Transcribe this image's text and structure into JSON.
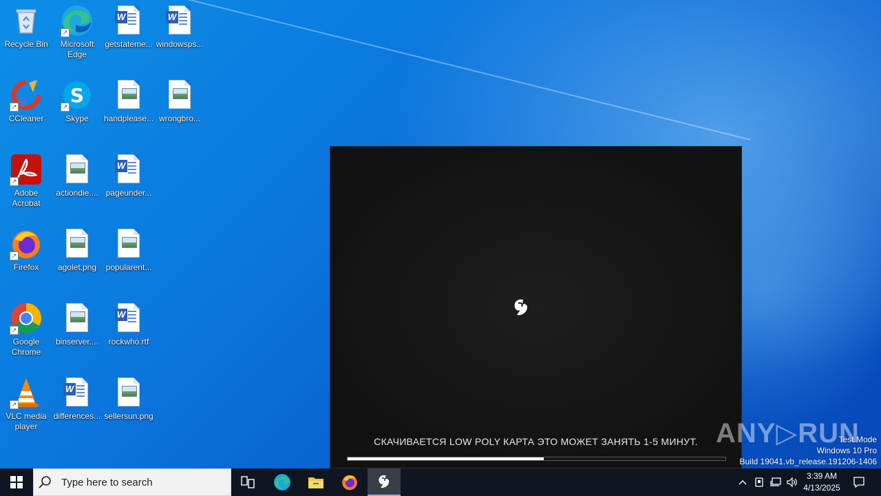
{
  "desktop": {
    "icons": [
      {
        "label": "Recycle Bin",
        "kind": "recycle-bin-icon"
      },
      {
        "label": "Microsoft Edge",
        "kind": "edge-icon"
      },
      {
        "label": "getstateme...",
        "kind": "word-doc-icon"
      },
      {
        "label": "windowsps...",
        "kind": "word-doc-icon"
      },
      {
        "label": "CCleaner",
        "kind": "ccleaner-icon"
      },
      {
        "label": "Skype",
        "kind": "skype-icon"
      },
      {
        "label": "handplease...",
        "kind": "image-file-icon"
      },
      {
        "label": "wrongbro...",
        "kind": "image-file-icon"
      },
      {
        "label": "Adobe Acrobat",
        "kind": "acrobat-icon"
      },
      {
        "label": "actiondie....",
        "kind": "image-file-icon"
      },
      {
        "label": "pageunder...",
        "kind": "word-doc-icon"
      },
      {
        "label": "Firefox",
        "kind": "firefox-icon"
      },
      {
        "label": "agolet.png",
        "kind": "image-file-icon"
      },
      {
        "label": "popularent...",
        "kind": "image-file-icon"
      },
      {
        "label": "Google Chrome",
        "kind": "chrome-icon"
      },
      {
        "label": "binserver....",
        "kind": "image-file-icon"
      },
      {
        "label": "rockwho.rtf",
        "kind": "word-doc-icon"
      },
      {
        "label": "VLC media player",
        "kind": "vlc-icon"
      },
      {
        "label": "differences...",
        "kind": "word-doc-icon"
      },
      {
        "label": "sellersun.png",
        "kind": "image-file-icon"
      }
    ]
  },
  "loader": {
    "status_text": "СКАЧИВАЕТСЯ LOW POLY КАРТА ЭТО МОЖЕТ ЗАНЯТЬ 1-5 МИНУТ.",
    "progress_fraction": 0.52
  },
  "watermark": {
    "brand": "ANY RUN",
    "mode": "Test Mode",
    "os": "Windows 10 Pro",
    "build": "Build 19041.vb_release.191206-1406"
  },
  "taskbar": {
    "search_placeholder": "Type here to search",
    "apps": [
      "task-view-icon",
      "edge-icon",
      "file-explorer-icon",
      "firefox-icon",
      "launcher-app-icon"
    ],
    "time": "3:39 AM",
    "date": "4/13/2025"
  },
  "colors": {
    "taskbar_bg": "#0f1621",
    "loader_bg": "#121212",
    "desktop_accent": "#0b78de"
  }
}
